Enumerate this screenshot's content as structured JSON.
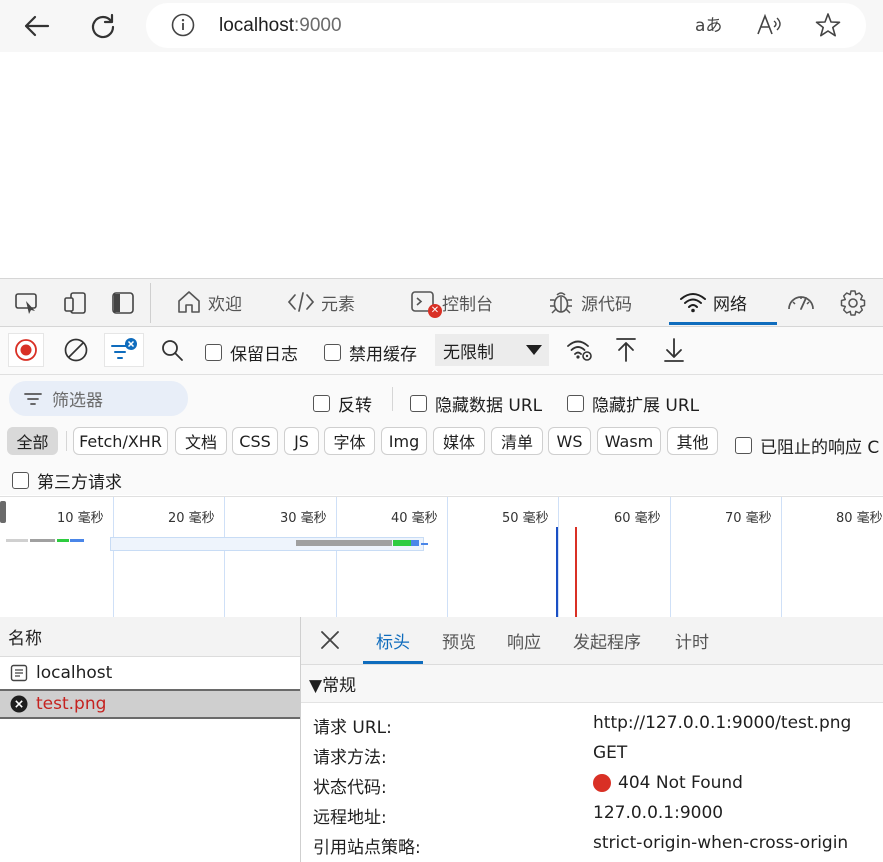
{
  "browser": {
    "url_host": "localhost",
    "url_port": ":9000",
    "icons": [
      "back-icon",
      "refresh-icon",
      "info-icon",
      "read-aloud-icon",
      "text-aa-icon",
      "favorite-star-icon"
    ]
  },
  "devtools": {
    "tabs": [
      {
        "label": "欢迎"
      },
      {
        "label": "元素"
      },
      {
        "label": "控制台"
      },
      {
        "label": "源代码"
      },
      {
        "label": "网络"
      }
    ],
    "accent": "#0f6cbd"
  },
  "toolbar": {
    "preserve_log": "保留日志",
    "disable_cache": "禁用缓存",
    "throttle": "无限制"
  },
  "filters": {
    "placeholder": "筛选器",
    "invert": "反转",
    "hide_data_urls": "隐藏数据 URL",
    "hide_ext_urls": "隐藏扩展 URL",
    "types": [
      "全部",
      "Fetch/XHR",
      "文档",
      "CSS",
      "JS",
      "字体",
      "Img",
      "媒体",
      "清单",
      "WS",
      "Wasm",
      "其他"
    ],
    "blocked": "已阻止的响应 C",
    "third_party": "第三方请求"
  },
  "overview": {
    "ticks": [
      "10 毫秒",
      "20 毫秒",
      "30 毫秒",
      "40 毫秒",
      "50 毫秒",
      "60 毫秒",
      "70 毫秒",
      "80 毫秒"
    ]
  },
  "requests": {
    "header": "名称",
    "items": [
      {
        "name": "localhost",
        "status": "ok"
      },
      {
        "name": "test.png",
        "status": "error"
      }
    ]
  },
  "details": {
    "tabs": [
      "标头",
      "预览",
      "响应",
      "发起程序",
      "计时"
    ],
    "section": "▼常规",
    "rows": [
      {
        "key": "请求 URL:",
        "value": "http://127.0.0.1:9000/test.png"
      },
      {
        "key": "请求方法:",
        "value": "GET"
      },
      {
        "key": "状态代码:",
        "value": "404 Not Found"
      },
      {
        "key": "远程地址:",
        "value": "127.0.0.1:9000"
      },
      {
        "key": "引用站点策略:",
        "value": "strict-origin-when-cross-origin"
      }
    ],
    "error_color": "#d93025"
  }
}
